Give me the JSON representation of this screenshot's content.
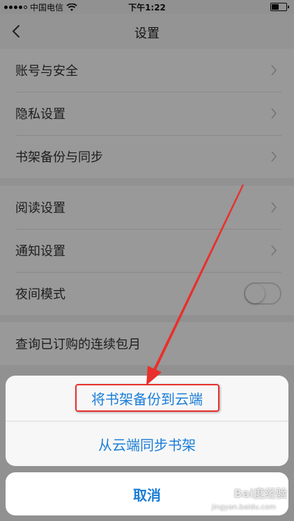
{
  "status_bar": {
    "carrier": "中国电信",
    "time": "下午1:22",
    "battery_level": 0.55,
    "wifi_icon": "wifi-icon"
  },
  "nav": {
    "title": "设置",
    "back_icon": "back-chevron-icon"
  },
  "groups": [
    {
      "items": [
        {
          "label": "账号与安全",
          "type": "link"
        },
        {
          "label": "隐私设置",
          "type": "link"
        },
        {
          "label": "书架备份与同步",
          "type": "link"
        }
      ]
    },
    {
      "items": [
        {
          "label": "阅读设置",
          "type": "link"
        },
        {
          "label": "通知设置",
          "type": "link"
        },
        {
          "label": "夜间模式",
          "type": "toggle",
          "on": false
        }
      ]
    },
    {
      "items": [
        {
          "label": "查询已订购的连续包月",
          "type": "link"
        }
      ]
    }
  ],
  "action_sheet": {
    "options": [
      {
        "label": "将书架备份到云端",
        "highlighted": true
      },
      {
        "label": "从云端同步书架",
        "highlighted": false
      }
    ],
    "cancel_label": "取消"
  },
  "annotation": {
    "color": "#e8302c"
  },
  "watermark": {
    "text": "Bai度经验",
    "sub": "jingyan.baidu.com"
  },
  "colors": {
    "accent": "#1a7dd8",
    "annotation_red": "#e8302c"
  }
}
